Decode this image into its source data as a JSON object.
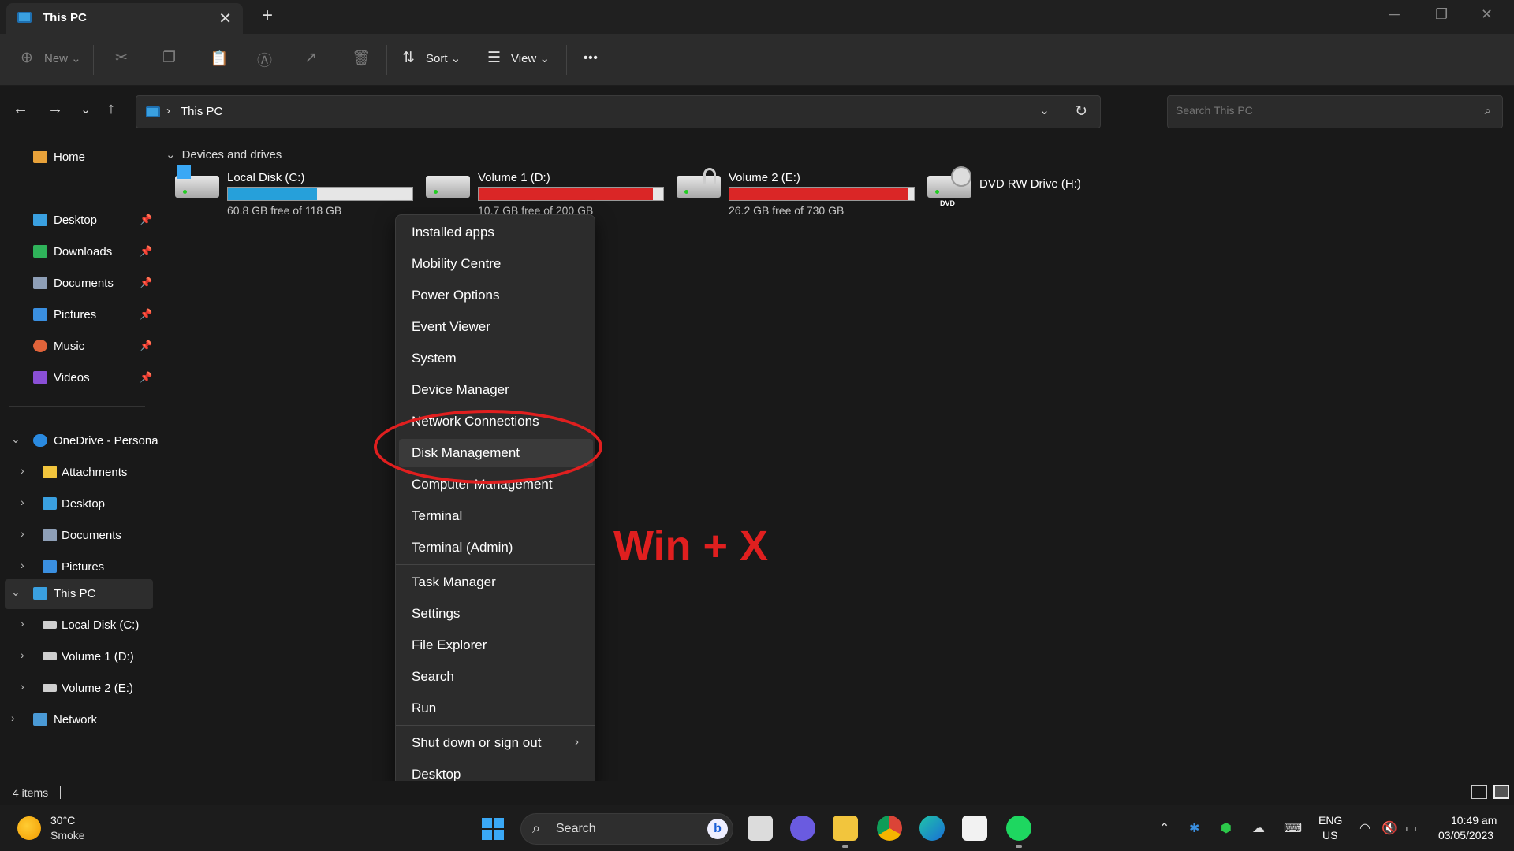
{
  "window": {
    "tab_title": "This PC",
    "close_tab": "✕",
    "new_tab": "+"
  },
  "toolbar": {
    "new_label": "New",
    "sort_label": "Sort",
    "view_label": "View",
    "more_label": "•••"
  },
  "address": {
    "crumb": "This PC",
    "search_placeholder": "Search This PC"
  },
  "sidebar": {
    "home": "Home",
    "pinned": [
      {
        "label": "Desktop",
        "color": "#3aa0e0"
      },
      {
        "label": "Downloads",
        "color": "#2fb35a"
      },
      {
        "label": "Documents",
        "color": "#8e9fb7"
      },
      {
        "label": "Pictures",
        "color": "#3a8fe0"
      },
      {
        "label": "Music",
        "color": "#e0633a"
      },
      {
        "label": "Videos",
        "color": "#8a4fd6"
      }
    ],
    "onedrive": "OneDrive - Persona",
    "onedrive_children": [
      "Attachments",
      "Desktop",
      "Documents",
      "Pictures"
    ],
    "this_pc": "This PC",
    "this_pc_children": [
      "Local Disk (C:)",
      "Volume 1 (D:)",
      "Volume 2 (E:)"
    ],
    "network": "Network"
  },
  "content": {
    "group_title": "Devices and drives",
    "drives": [
      {
        "name": "Local Disk (C:)",
        "free": "60.8 GB free of 118 GB",
        "used_fraction": 0.485,
        "bar_color": "#26a0da"
      },
      {
        "name": "Volume 1 (D:)",
        "free": "10.7 GB free of 200 GB",
        "used_fraction": 0.946,
        "bar_color": "#da2626"
      },
      {
        "name": "Volume 2 (E:)",
        "free": "26.2 GB free of 730 GB",
        "used_fraction": 0.964,
        "bar_color": "#da2626"
      },
      {
        "name": "DVD RW Drive (H:)",
        "free": "",
        "used_fraction": 0,
        "bar_color": ""
      }
    ],
    "dvd_badge": "DVD"
  },
  "context_menu": {
    "items": [
      "Installed apps",
      "Mobility Centre",
      "Power Options",
      "Event Viewer",
      "System",
      "Device Manager",
      "Network Connections",
      "Disk Management",
      "Computer Management",
      "Terminal",
      "Terminal (Admin)",
      "Task Manager",
      "Settings",
      "File Explorer",
      "Search",
      "Run",
      "Shut down or sign out",
      "Desktop"
    ],
    "highlighted": "Disk Management"
  },
  "annotation": "Win + X",
  "status": {
    "item_count": "4 items"
  },
  "taskbar": {
    "temperature": "30°C",
    "weather": "Smoke",
    "search_label": "Search",
    "bing_letter": "b",
    "lang_line1": "ENG",
    "lang_line2": "US",
    "time": "10:49 am",
    "date": "03/05/2023"
  }
}
